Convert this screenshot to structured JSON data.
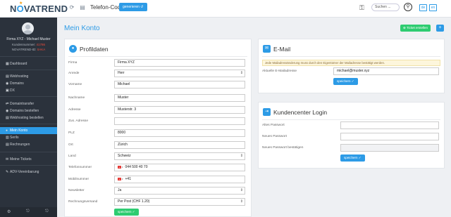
{
  "topbar": {
    "logo_pre": "N",
    "logo_o": "O",
    "logo_post": "VATREND",
    "star": "★",
    "phone_label": "Telefon-Code",
    "phone_button": "generieren ↺",
    "search_placeholder": "Suchen ...",
    "search_icon": "⚲",
    "key_icon": "⚿",
    "lang_de": "de",
    "lang_en": "en",
    "icons": {
      "back": "⟳",
      "menu": "▤"
    }
  },
  "sidebar": {
    "user_name": "Firma XYZ - Michael Muster",
    "customer_label": "Kundennummer:",
    "customer_value": "41786",
    "novatrend_label": "NOVATREND-ID:",
    "novatrend_value": "0AKA",
    "items": [
      {
        "icon": "▦",
        "label": "Dashboard"
      },
      {
        "icon": "▤",
        "label": "Webhosting"
      },
      {
        "icon": "◉",
        "label": "Domains"
      },
      {
        "icon": "▣",
        "label": "DX"
      },
      {
        "icon": "⇄",
        "label": "Domaintransfer"
      },
      {
        "icon": "◉",
        "label": "Domains bestellen"
      },
      {
        "icon": "▤",
        "label": "Webhosting bestellen"
      },
      {
        "icon": "●",
        "label": "Mein Konto"
      },
      {
        "icon": "▥",
        "label": "Serils"
      },
      {
        "icon": "▤",
        "label": "Rechnungen"
      },
      {
        "icon": "✉",
        "label": "Meine Tickets"
      },
      {
        "icon": "✎",
        "label": "ADV-Vereinbarung"
      }
    ],
    "footer_icons": [
      "⚙",
      "⎋",
      "⎋"
    ]
  },
  "main": {
    "title": "Mein Konto",
    "ticket_button": "⊕ Ticket erstellen",
    "plus_button": "+"
  },
  "profil": {
    "title": "Profildaten",
    "icon": "●",
    "fields": [
      {
        "label": "Firma",
        "value": "Firma XYZ"
      },
      {
        "label": "Anrede",
        "value": "Herr",
        "select": true
      },
      {
        "label": "Vorname",
        "value": "Michael"
      },
      {
        "label": "Nachname",
        "value": "Muster"
      },
      {
        "label": "Adresse",
        "value": "Musterstr. 3"
      },
      {
        "label": "Zus. Adresse",
        "value": ""
      },
      {
        "label": "PLZ",
        "value": "8000"
      },
      {
        "label": "Ort",
        "value": "Zürich"
      },
      {
        "label": "Land",
        "value": "Schweiz",
        "select": true
      },
      {
        "label": "Telefonnummer",
        "value": "044 500 40 70",
        "flag": true
      },
      {
        "label": "Mobilnummer",
        "value": "+41",
        "flag": true
      },
      {
        "label": "Newsletter",
        "value": "Ja",
        "select": true
      },
      {
        "label": "Rechnungsversand",
        "value": "Per Post (CHF 1.20)",
        "select": true
      }
    ],
    "save_button": "speichern ✓",
    "flag_text": "+",
    "flag_caret": "▾",
    "select_caret": "⇕"
  },
  "email": {
    "title": "E-Mail",
    "icon": "✉",
    "notice": "Jede Mailadressänderung muss durch den Eigentümer der Mailadresse bestätigt werden.",
    "label": "Aktuelle E-Mailadresse",
    "value": "michael@muster.xyz",
    "save_button": "speichern ✓"
  },
  "login": {
    "title": "Kundencenter Login",
    "icon": "⇥",
    "fields": [
      {
        "label": "Altes Passwort",
        "value": ""
      },
      {
        "label": "Neues Passwort",
        "value": ""
      },
      {
        "label": "Neues Passwort bestätigen",
        "value": ""
      }
    ],
    "save_button": "speichern ✓"
  }
}
